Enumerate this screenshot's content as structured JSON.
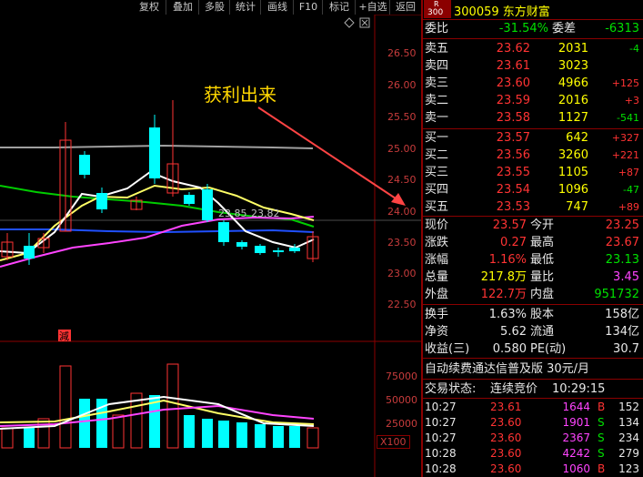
{
  "toolbar": {
    "buttons": [
      "复权",
      "叠加",
      "多股",
      "统计",
      "画线",
      "F10",
      "标记",
      "+自选",
      "返回"
    ]
  },
  "chart": {
    "annotation": "获利出来",
    "price_axis": [
      "26.50",
      "26.00",
      "25.50",
      "25.00",
      "24.50",
      "24.00",
      "23.50",
      "23.00",
      "22.50"
    ],
    "price_tags": [
      "23.85",
      "23.82"
    ],
    "volume_axis": [
      "75000",
      "50000",
      "25000"
    ],
    "volume_unit": "X100",
    "badge": "減"
  },
  "stock": {
    "market_tag": "R",
    "market_code": "300",
    "code_name": "300059 东方财富"
  },
  "ratio": {
    "wb_label": "委比",
    "wb_value": "-31.54%",
    "wc_label": "委差",
    "wc_value": "-6313"
  },
  "asks": [
    {
      "label": "卖五",
      "price": "23.62",
      "vol": "2031",
      "chg": "-4"
    },
    {
      "label": "卖四",
      "price": "23.61",
      "vol": "3023",
      "chg": ""
    },
    {
      "label": "卖三",
      "price": "23.60",
      "vol": "4966",
      "chg": "+125"
    },
    {
      "label": "卖二",
      "price": "23.59",
      "vol": "2016",
      "chg": "+3"
    },
    {
      "label": "卖一",
      "price": "23.58",
      "vol": "1127",
      "chg": "-541"
    }
  ],
  "bids": [
    {
      "label": "买一",
      "price": "23.57",
      "vol": "642",
      "chg": "+327"
    },
    {
      "label": "买二",
      "price": "23.56",
      "vol": "3260",
      "chg": "+221"
    },
    {
      "label": "买三",
      "price": "23.55",
      "vol": "1105",
      "chg": "+87"
    },
    {
      "label": "买四",
      "price": "23.54",
      "vol": "1096",
      "chg": "-47"
    },
    {
      "label": "买五",
      "price": "23.53",
      "vol": "747",
      "chg": "+89"
    }
  ],
  "quote": [
    {
      "l1": "现价",
      "v1": "23.57",
      "l2": "今开",
      "v2": "23.25"
    },
    {
      "l1": "涨跌",
      "v1": "0.27",
      "l2": "最高",
      "v2": "23.67"
    },
    {
      "l1": "涨幅",
      "v1": "1.16%",
      "l2": "最低",
      "v2": "23.13"
    },
    {
      "l1": "总量",
      "v1": "217.8万",
      "l2": "量比",
      "v2": "3.45"
    },
    {
      "l1": "外盘",
      "v1": "122.7万",
      "l2": "内盘",
      "v2": "951732"
    }
  ],
  "finance": [
    {
      "l1": "换手",
      "v1": "1.63%",
      "l2": "股本",
      "v2": "158亿"
    },
    {
      "l1": "净资",
      "v1": "5.62",
      "l2": "流通",
      "v2": "134亿"
    },
    {
      "l1": "收益(三)",
      "v1": "0.580",
      "l2": "PE(动)",
      "v2": "30.7"
    }
  ],
  "promo": "自动续费通达信普及版 30元/月",
  "status": {
    "label": "交易状态:",
    "value": "连续竞价",
    "time": "10:29:15"
  },
  "ticks": [
    {
      "time": "10:27",
      "price": "23.61",
      "vol": "1644",
      "side": "B",
      "num": "152"
    },
    {
      "time": "10:27",
      "price": "23.60",
      "vol": "1901",
      "side": "S",
      "num": "134"
    },
    {
      "time": "10:27",
      "price": "23.60",
      "vol": "2367",
      "side": "S",
      "num": "234"
    },
    {
      "time": "10:28",
      "price": "23.60",
      "vol": "4242",
      "side": "S",
      "num": "279"
    },
    {
      "time": "10:28",
      "price": "23.60",
      "vol": "1060",
      "side": "B",
      "num": "123"
    }
  ]
}
